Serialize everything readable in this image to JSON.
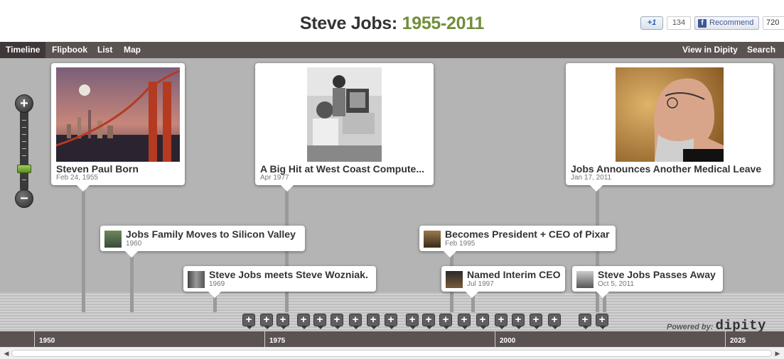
{
  "header": {
    "title_main": "Steve Jobs:",
    "title_years": "1955-2011",
    "google_plus_label": "+1",
    "google_plus_count": "134",
    "fb_icon": "f",
    "fb_label": "Recommend",
    "fb_count": "720"
  },
  "nav": {
    "tabs": [
      {
        "label": "Timeline"
      },
      {
        "label": "Flipbook"
      },
      {
        "label": "List"
      },
      {
        "label": "Map"
      }
    ],
    "right": [
      {
        "label": "View in Dipity"
      },
      {
        "label": "Search"
      }
    ]
  },
  "events": {
    "big": [
      {
        "title": "Steven Paul Born",
        "date": "Feb 24, 1955",
        "image": "golden-gate-bridge-photo"
      },
      {
        "title": "A Big Hit at West Coast Compute...",
        "date": "Apr 1977",
        "image": "jobs-wozniak-photo"
      },
      {
        "title": "Jobs Announces Another Medical Leave",
        "date": "Jan 17, 2011",
        "image": "steve-jobs-portrait-photo"
      }
    ],
    "small": [
      {
        "title": "Jobs Family Moves to Silicon Valley",
        "date": "1960"
      },
      {
        "title": "Steve Jobs meets Steve Wozniak.",
        "date": "1969"
      },
      {
        "title": "Becomes President + CEO of Pixar",
        "date": "Feb 1995"
      },
      {
        "title": "Named Interim CEO",
        "date": "Jul 1997"
      },
      {
        "title": "Steve Jobs Passes Away",
        "date": "Oct 5, 2011"
      }
    ]
  },
  "zoom": {
    "in_label": "+",
    "out_label": "−"
  },
  "cluster_label": "+",
  "powered": {
    "prefix": "Powered by:",
    "brand": "dipity"
  },
  "axis": {
    "years": [
      "1950",
      "1975",
      "2000",
      "2025"
    ]
  },
  "scrollbar": {
    "left_arrow": "◀",
    "right_arrow": "▶"
  }
}
